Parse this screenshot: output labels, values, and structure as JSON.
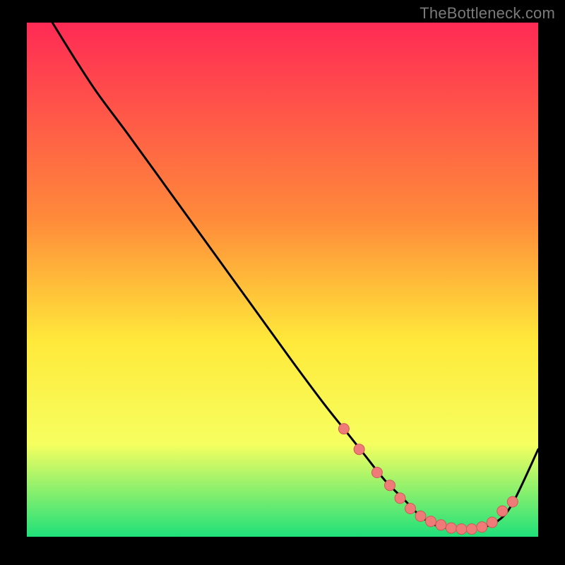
{
  "watermark": "TheBottleneck.com",
  "colors": {
    "frame_bg": "#000000",
    "watermark": "#7a7a7a",
    "curve": "#000000",
    "marker_fill": "#ef7b78",
    "marker_stroke": "#cf5a57",
    "grad_top": "#ff2a55",
    "grad_mid1": "#ff8a3a",
    "grad_mid2": "#ffe93a",
    "grad_mid3": "#f6ff60",
    "grad_bottom": "#1fe07a"
  },
  "chart_data": {
    "type": "line",
    "title": "",
    "xlabel": "",
    "ylabel": "",
    "xlim": [
      0,
      100
    ],
    "ylim": [
      0,
      100
    ],
    "series": [
      {
        "name": "bottleneck-curve",
        "x": [
          5,
          10,
          14,
          20,
          28,
          36,
          44,
          52,
          58,
          62,
          66,
          70,
          74,
          77,
          80,
          83,
          86,
          89,
          92,
          95,
          100
        ],
        "y": [
          100,
          92,
          86,
          78,
          67,
          56,
          45,
          34,
          26,
          21,
          16,
          11,
          7,
          4,
          2.2,
          1.6,
          1.4,
          1.8,
          3.0,
          6.5,
          17
        ]
      }
    ],
    "markers": {
      "name": "highlight-dots",
      "x": [
        62,
        65,
        68.5,
        71,
        73,
        75,
        77,
        79,
        81,
        83,
        85,
        87,
        89,
        91,
        93,
        95
      ],
      "y": [
        21,
        17,
        12.5,
        10,
        7.5,
        5.5,
        4,
        3,
        2.3,
        1.7,
        1.5,
        1.5,
        1.9,
        2.8,
        5.0,
        6.8
      ]
    },
    "gradient_stops": [
      {
        "offset": 0.0,
        "color": "#ff2a55"
      },
      {
        "offset": 0.38,
        "color": "#ff8a3a"
      },
      {
        "offset": 0.62,
        "color": "#ffe93a"
      },
      {
        "offset": 0.82,
        "color": "#f6ff60"
      },
      {
        "offset": 1.0,
        "color": "#1fe07a"
      }
    ]
  }
}
